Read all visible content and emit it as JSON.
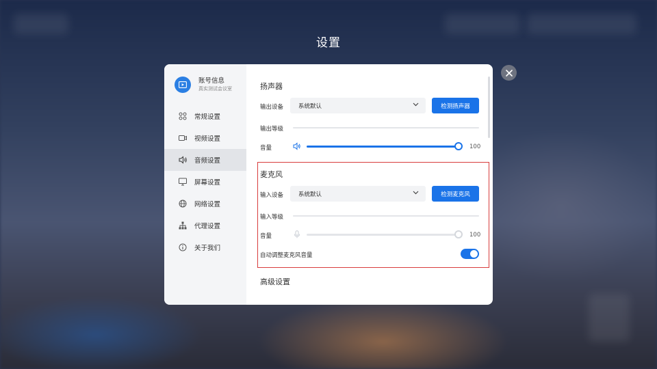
{
  "page": {
    "title": "设置"
  },
  "account": {
    "name": "账号信息",
    "subtitle": "真实测试会议室"
  },
  "sidebar": {
    "items": [
      {
        "label": "常规设置",
        "icon": "grid-icon",
        "active": false
      },
      {
        "label": "视频设置",
        "icon": "video-camera-icon",
        "active": false
      },
      {
        "label": "音频设置",
        "icon": "speaker-icon",
        "active": true
      },
      {
        "label": "屏幕设置",
        "icon": "monitor-icon",
        "active": false
      },
      {
        "label": "网络设置",
        "icon": "globe-icon",
        "active": false
      },
      {
        "label": "代理设置",
        "icon": "network-tree-icon",
        "active": false
      },
      {
        "label": "关于我们",
        "icon": "info-icon",
        "active": false
      }
    ]
  },
  "speaker": {
    "section_title": "扬声器",
    "output_device_label": "输出设备",
    "output_device_value": "系统默认",
    "test_button": "检测扬声器",
    "output_level_label": "输出等级",
    "volume_label": "音量",
    "volume_value": "100",
    "volume_fraction": 1.0
  },
  "microphone": {
    "section_title": "麦克风",
    "input_device_label": "输入设备",
    "input_device_value": "系统默认",
    "test_button": "检测麦克风",
    "input_level_label": "输入等级",
    "volume_label": "音量",
    "volume_value": "100",
    "volume_fraction": 1.0,
    "auto_adjust_label": "自动调整麦克风音量",
    "auto_adjust_on": true
  },
  "advanced": {
    "section_title": "高级设置"
  },
  "colors": {
    "accent": "#1a73e8",
    "highlight_border": "#d83c3c"
  }
}
